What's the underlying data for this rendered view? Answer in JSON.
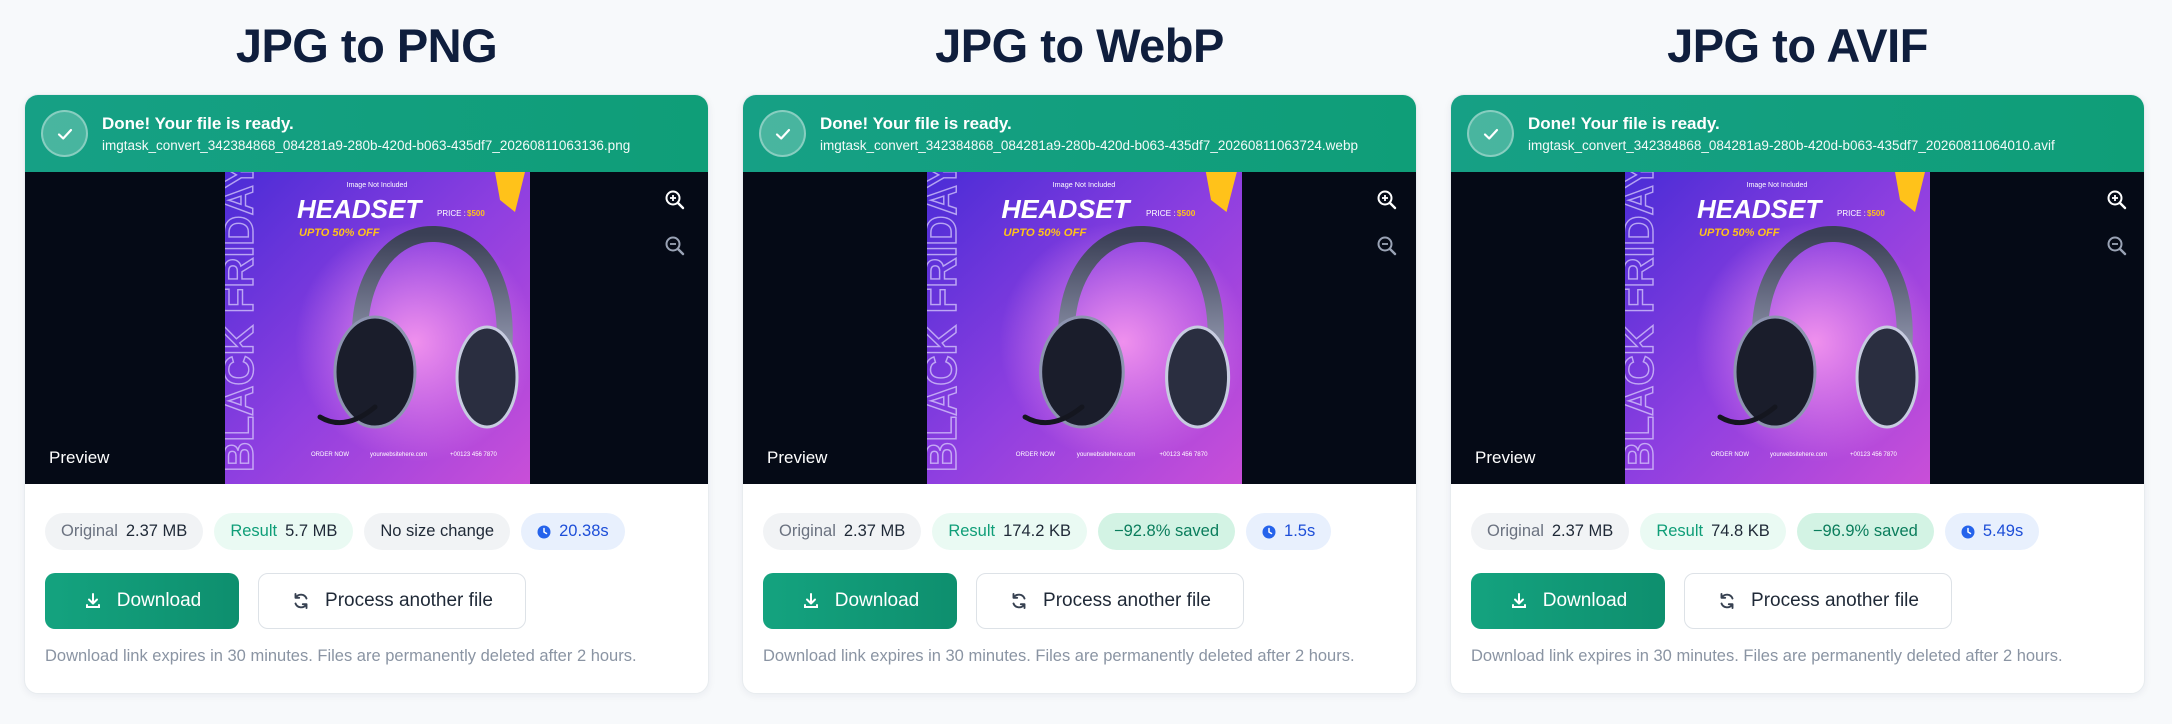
{
  "colors": {
    "banner_green": "#16a085",
    "primary_button": "#14a37f",
    "title_navy": "#0f1e3d",
    "preview_bg": "#050a16"
  },
  "icons": {
    "success": "check-icon",
    "zoom_in": "zoom-in-icon",
    "zoom_out": "zoom-out-icon",
    "download": "download-icon",
    "refresh": "refresh-icon",
    "timer": "clock-icon"
  },
  "panels": [
    {
      "title": "JPG to PNG",
      "status": "Done! Your file is ready.",
      "filename": "imgtask_convert_342384868_084281a9-280b-420d-b063-435df7_20260811063136.png",
      "preview_label": "Preview",
      "original_key": "Original",
      "original_size": "2.37 MB",
      "result_key": "Result",
      "result_size": "5.7 MB",
      "change": "No size change",
      "time": "20.38s",
      "download_label": "Download",
      "process_label": "Process another file",
      "footnote": "Download link expires in 30 minutes. Files are permanently deleted after 2 hours."
    },
    {
      "title": "JPG to WebP",
      "status": "Done! Your file is ready.",
      "filename": "imgtask_convert_342384868_084281a9-280b-420d-b063-435df7_20260811063724.webp",
      "preview_label": "Preview",
      "original_key": "Original",
      "original_size": "2.37 MB",
      "result_key": "Result",
      "result_size": "174.2 KB",
      "change": "−92.8% saved",
      "time": "1.5s",
      "download_label": "Download",
      "process_label": "Process another file",
      "footnote": "Download link expires in 30 minutes. Files are permanently deleted after 2 hours."
    },
    {
      "title": "JPG to AVIF",
      "status": "Done! Your file is ready.",
      "filename": "imgtask_convert_342384868_084281a9-280b-420d-b063-435df7_20260811064010.avif",
      "preview_label": "Preview",
      "original_key": "Original",
      "original_size": "2.37 MB",
      "result_key": "Result",
      "result_size": "74.8 KB",
      "change": "−96.9% saved",
      "time": "5.49s",
      "download_label": "Download",
      "process_label": "Process another file",
      "footnote": "Download link expires in 30 minutes. Files are permanently deleted after 2 hours."
    }
  ],
  "poster": {
    "top_note": "Image Not Included",
    "headline": "HEADSET",
    "price_label": "PRICE :",
    "price": "$500",
    "discount": "UPTO 50% OFF",
    "vertical_text": "BLACK FRIDAY",
    "cta": "ORDER NOW",
    "website": "yourwebsitehere.com",
    "phone": "+00123 456 7870"
  }
}
